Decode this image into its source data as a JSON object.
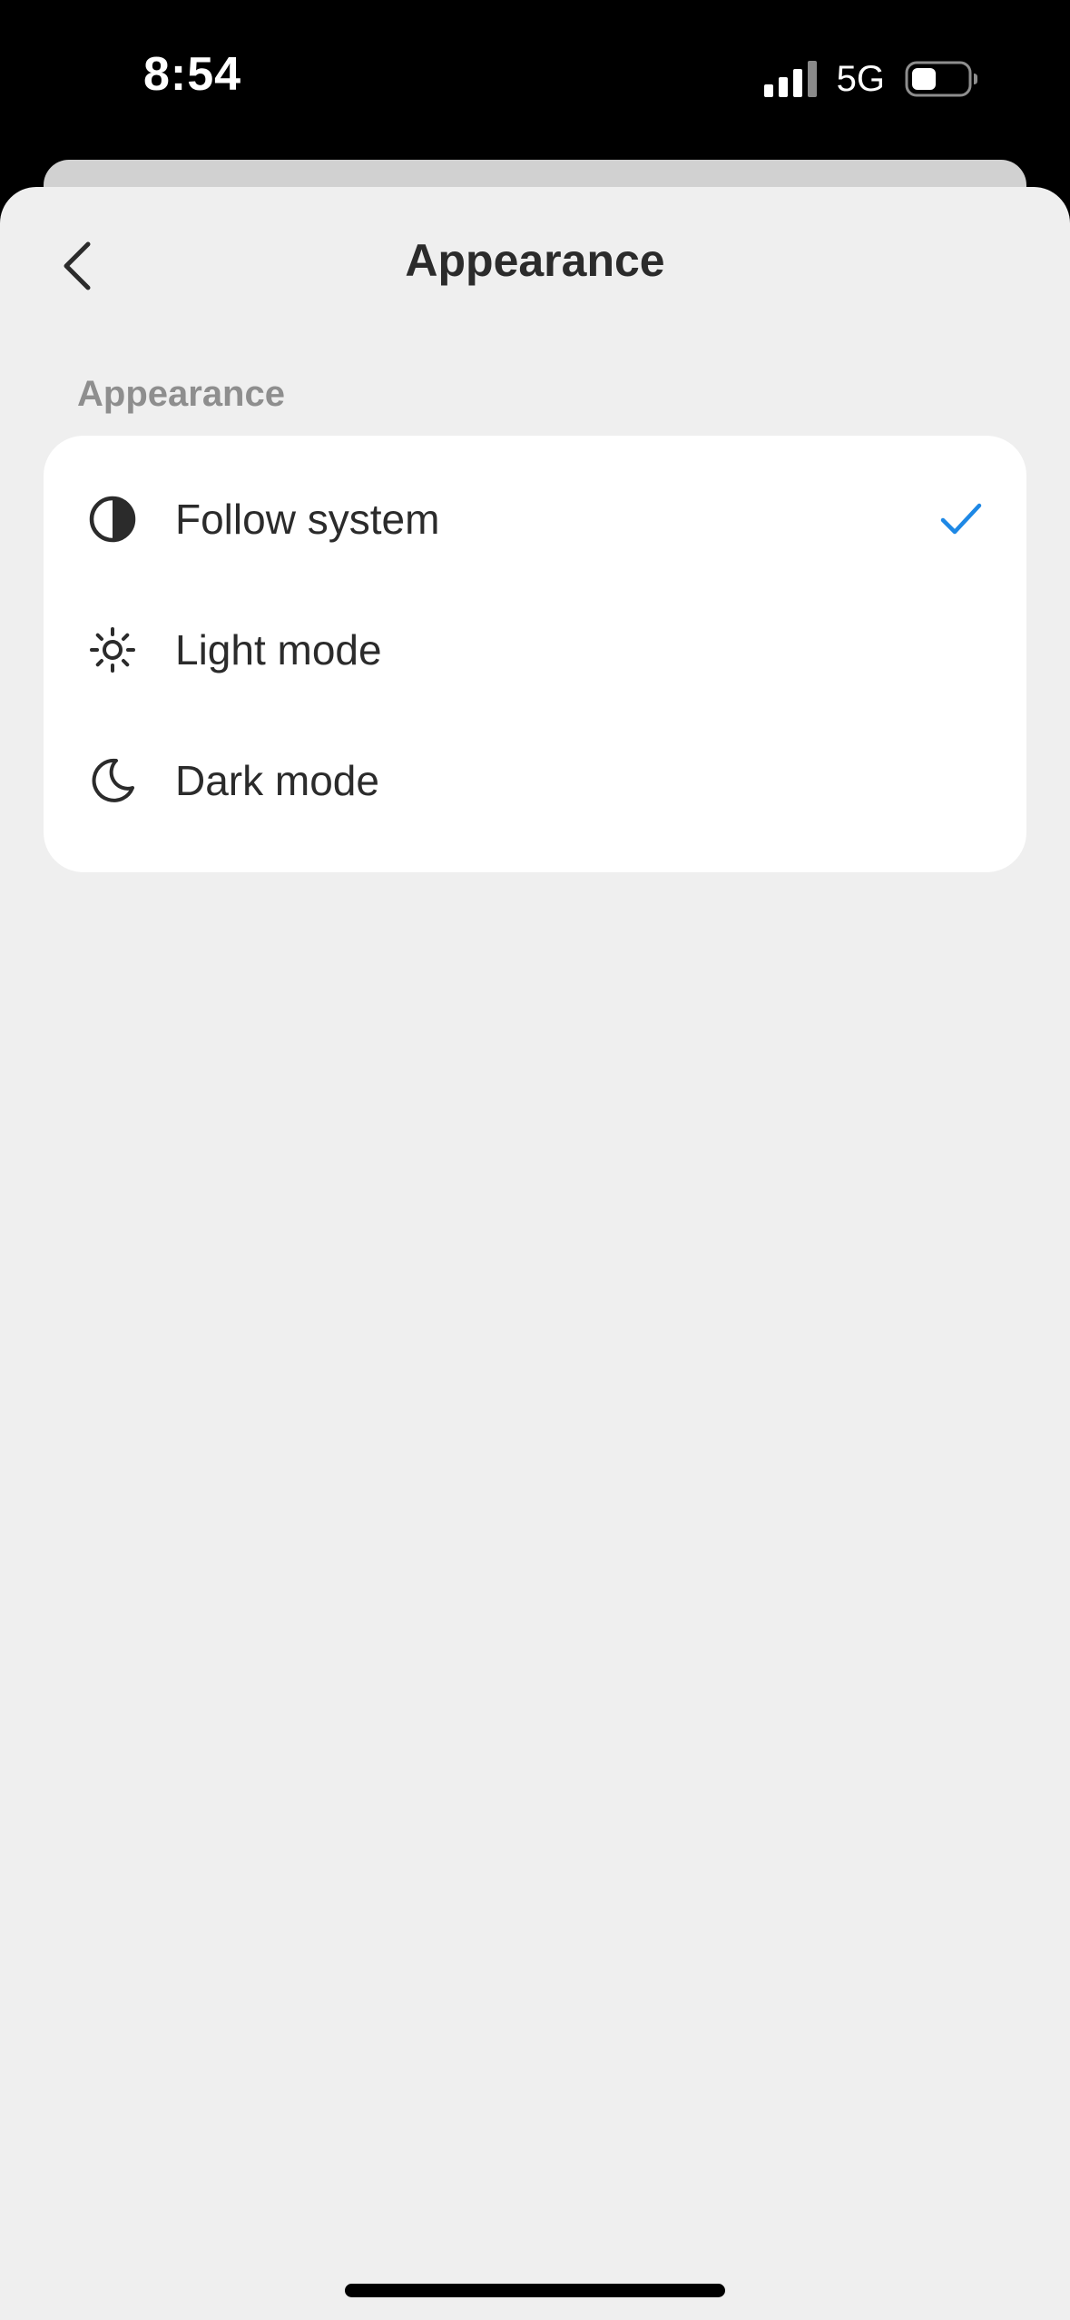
{
  "status_bar": {
    "time": "8:54",
    "network": "5G",
    "icons": [
      "signal-bars-icon",
      "battery-icon"
    ]
  },
  "header": {
    "back_icon": "chevron-left-icon",
    "title": "Appearance"
  },
  "section": {
    "label": "Appearance"
  },
  "options": [
    {
      "label": "Follow system",
      "icon": "half-circle-contrast-icon",
      "selected": true
    },
    {
      "label": "Light mode",
      "icon": "sun-icon",
      "selected": false
    },
    {
      "label": "Dark mode",
      "icon": "moon-icon",
      "selected": false
    }
  ],
  "colors": {
    "accent_check": "#1e88e5",
    "sheet_background": "#efefef",
    "card_background": "#ffffff",
    "text_primary": "#2b2b2b",
    "text_secondary": "#8e8e8e"
  }
}
